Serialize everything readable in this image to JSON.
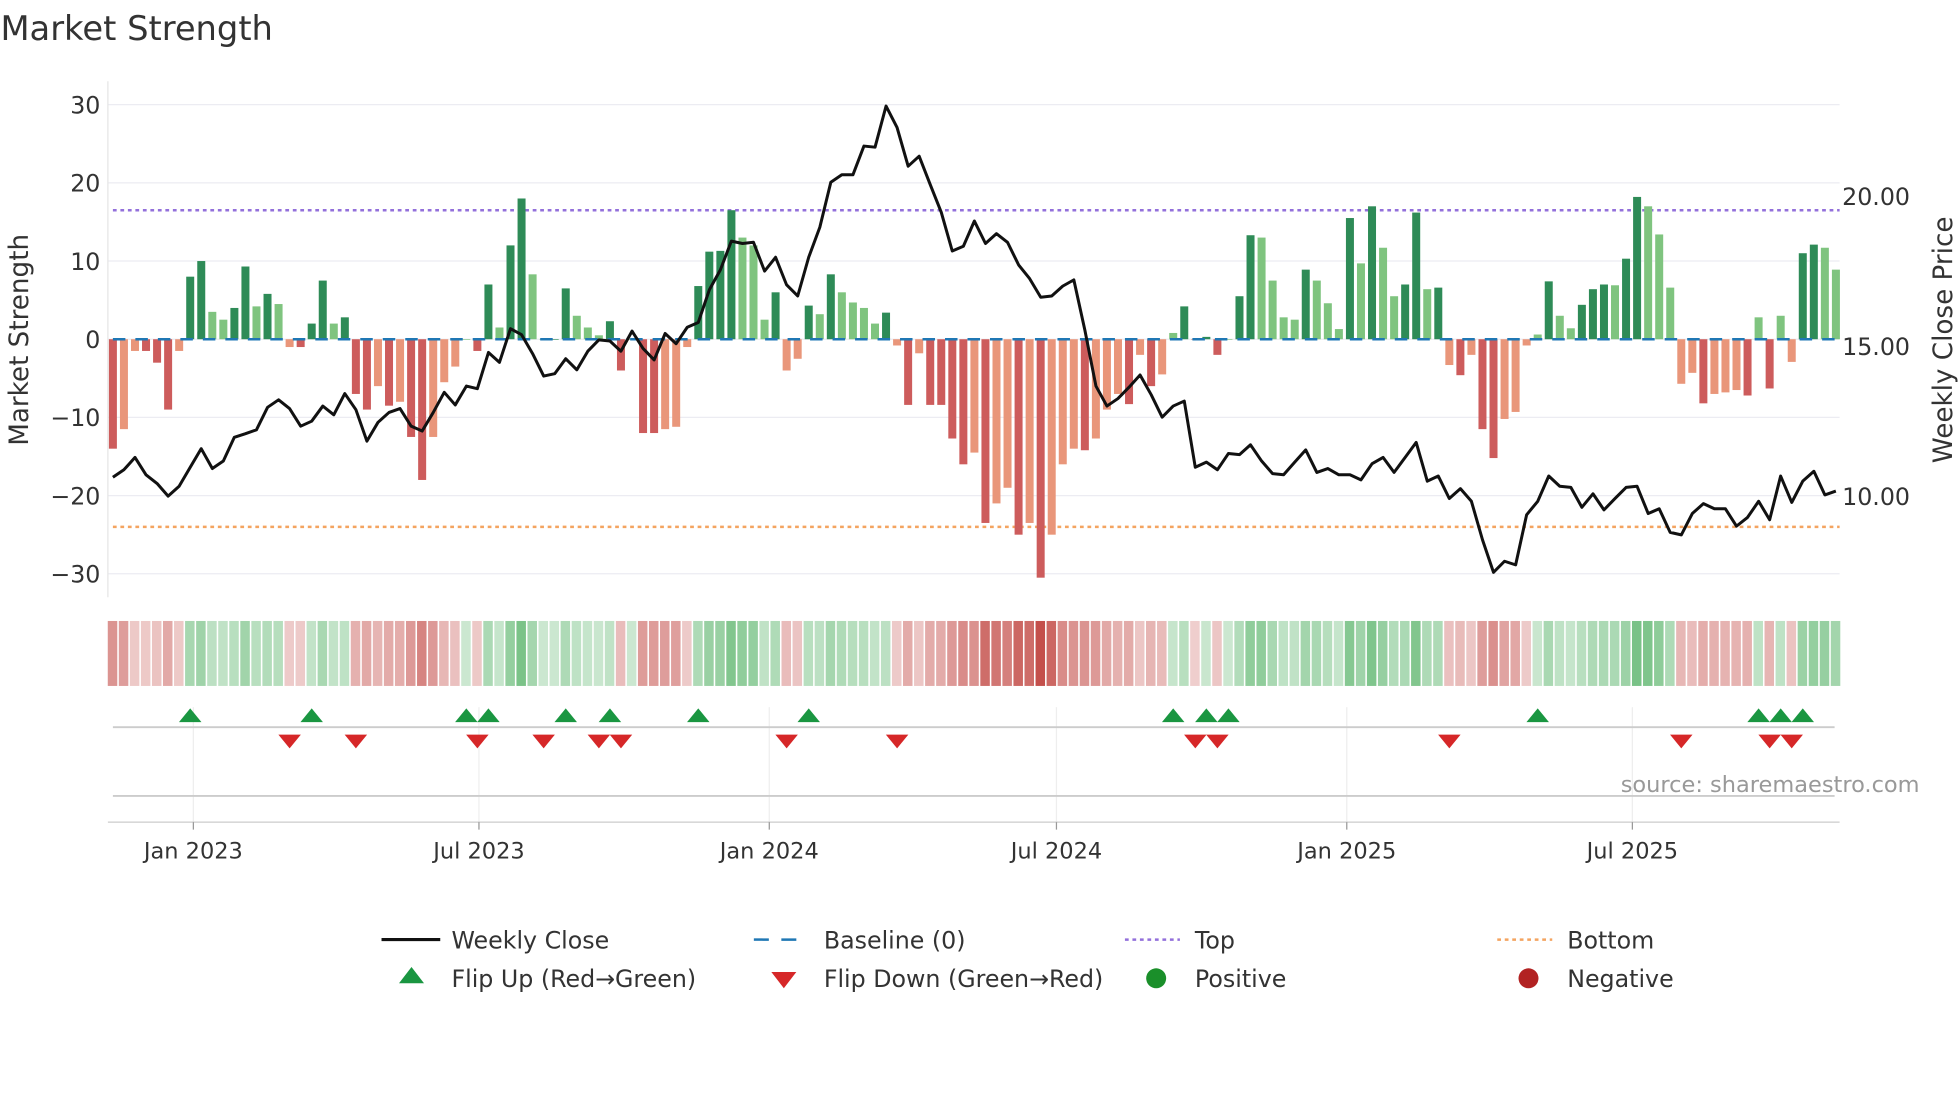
{
  "chart_data": {
    "type": "bar",
    "title": "Market Strength",
    "ylabel": "Market Strength",
    "y2label": "Weekly Close Price",
    "ylim": [
      -33,
      33
    ],
    "y2lim": [
      6.63,
      23.83
    ],
    "yticks": [
      30,
      20,
      10,
      0,
      -10,
      -20,
      -30
    ],
    "ytick_labels": [
      "30",
      "20",
      "10",
      "0",
      "−10",
      "−20",
      "−30"
    ],
    "y2ticks": [
      20,
      15,
      10
    ],
    "y2tick_labels": [
      "20.00",
      "15.00",
      "10.00"
    ],
    "x_start": "2022-11-11",
    "x_step_days": 7,
    "xticks": [
      {
        "date": "2023-01-01",
        "label": "Jan 2023"
      },
      {
        "date": "2023-07-01",
        "label": "Jul 2023"
      },
      {
        "date": "2024-01-01",
        "label": "Jan 2024"
      },
      {
        "date": "2024-07-01",
        "label": "Jul 2024"
      },
      {
        "date": "2025-01-01",
        "label": "Jan 2025"
      },
      {
        "date": "2025-07-01",
        "label": "Jul 2025"
      }
    ],
    "top_level": 16.5,
    "bottom_level": -24,
    "baseline": 0,
    "strength": [
      -14,
      -11.5,
      -1.5,
      -1.5,
      -3,
      -9,
      -1.5,
      8,
      10,
      3.5,
      2.5,
      4,
      9.3,
      4.2,
      5.8,
      4.5,
      -1,
      -1,
      2,
      7.5,
      2,
      2.8,
      -7,
      -9,
      -6,
      -8.5,
      -8,
      -12.5,
      -18,
      -12.5,
      -5.5,
      -3.5,
      0,
      -1.5,
      7,
      1.5,
      12,
      18,
      8.3,
      0,
      0,
      6.5,
      3,
      1.5,
      0.5,
      2.3,
      -4,
      0,
      -12,
      -12,
      -11.5,
      -11.2,
      -1,
      6.8,
      11.2,
      11.3,
      16.5,
      13,
      12,
      2.5,
      6,
      -4,
      -2.5,
      4.3,
      3.2,
      8.3,
      6,
      4.7,
      4,
      2,
      3.4,
      -0.8,
      -8.4,
      -1.8,
      -8.4,
      -8.4,
      -12.7,
      -16,
      -14.5,
      -23.5,
      -21,
      -19,
      -25,
      -23.5,
      -30.5,
      -25,
      -16,
      -14,
      -14.2,
      -12.7,
      -9,
      -7,
      -8.3,
      -2,
      -6,
      -4.5,
      0.8,
      4.2,
      -0.1,
      0.3,
      -2,
      0,
      5.5,
      13.3,
      13,
      7.5,
      2.8,
      2.5,
      8.9,
      7.5,
      4.6,
      1.3,
      15.5,
      9.7,
      17,
      11.7,
      5.5,
      7,
      16.2,
      6.4,
      6.6,
      -3.3,
      -4.6,
      -2,
      -11.5,
      -15.2,
      -10.2,
      -9.3,
      -0.8,
      0.6,
      7.4,
      3,
      1.4,
      4.4,
      6.4,
      7,
      6.9,
      10.3,
      18.2,
      17,
      13.4,
      6.6,
      -5.7,
      -4.3,
      -8.2,
      -7,
      -6.8,
      -6.5,
      -7.2,
      2.8,
      -6.3,
      3,
      -2.9,
      11,
      12.1,
      11.7,
      8.9
    ],
    "weekly_close": [
      10.63,
      10.88,
      11.29,
      10.71,
      10.42,
      10.0,
      10.33,
      10.96,
      11.58,
      10.92,
      11.17,
      11.96,
      12.08,
      12.21,
      12.96,
      13.21,
      12.92,
      12.33,
      12.5,
      13.0,
      12.71,
      13.42,
      12.88,
      11.83,
      12.46,
      12.79,
      12.92,
      12.33,
      12.17,
      12.79,
      13.46,
      13.04,
      13.67,
      13.58,
      14.79,
      14.46,
      15.58,
      15.38,
      14.75,
      14.0,
      14.08,
      14.58,
      14.21,
      14.83,
      15.21,
      15.17,
      14.83,
      15.5,
      14.92,
      14.54,
      15.42,
      15.08,
      15.63,
      15.79,
      16.88,
      17.54,
      18.5,
      18.42,
      18.46,
      17.5,
      17.96,
      17.04,
      16.67,
      17.96,
      18.96,
      20.46,
      20.71,
      20.71,
      21.67,
      21.63,
      23.0,
      22.29,
      21.0,
      21.33,
      20.38,
      19.46,
      18.17,
      18.33,
      19.17,
      18.42,
      18.75,
      18.46,
      17.71,
      17.25,
      16.63,
      16.67,
      17.0,
      17.21,
      15.54,
      13.67,
      13.0,
      13.25,
      13.63,
      14.04,
      13.38,
      12.63,
      13.0,
      13.17,
      10.96,
      11.13,
      10.88,
      11.42,
      11.38,
      11.71,
      11.17,
      10.75,
      10.71,
      11.13,
      11.54,
      10.79,
      10.92,
      10.71,
      10.71,
      10.54,
      11.08,
      11.29,
      10.79,
      11.29,
      11.79,
      10.5,
      10.67,
      9.92,
      10.25,
      9.83,
      8.54,
      7.46,
      7.83,
      7.71,
      9.38,
      9.83,
      10.67,
      10.33,
      10.29,
      9.63,
      10.08,
      9.54,
      9.92,
      10.29,
      10.33,
      9.42,
      9.58,
      8.79,
      8.71,
      9.42,
      9.75,
      9.58,
      9.58,
      9.0,
      9.29,
      9.83,
      9.21,
      10.67,
      9.79,
      10.5,
      10.83,
      10.04,
      10.17
    ],
    "flip_up_weeks": [
      7,
      18,
      32,
      34,
      41,
      45,
      53,
      63,
      96,
      99,
      101,
      129,
      149,
      151,
      153
    ],
    "flip_down_weeks": [
      16,
      22,
      33,
      39,
      44,
      46,
      61,
      71,
      98,
      100,
      121,
      142,
      150,
      152
    ],
    "legend": [
      {
        "key": "weekly-close",
        "label": "Weekly Close"
      },
      {
        "key": "baseline",
        "label": "Baseline (0)"
      },
      {
        "key": "top",
        "label": "Top"
      },
      {
        "key": "bottom",
        "label": "Bottom"
      },
      {
        "key": "flip-up",
        "label": "Flip Up (Red→Green)"
      },
      {
        "key": "flip-down",
        "label": "Flip Down (Green→Red)"
      },
      {
        "key": "positive",
        "label": "Positive"
      },
      {
        "key": "negative",
        "label": "Negative"
      }
    ],
    "legend_position": "bottom",
    "source": "source: sharemaestro.com"
  },
  "colors": {
    "pos_dark": "#2e8b57",
    "pos_light": "#7fc47f",
    "neg_dark": "#cd5c5c",
    "neg_light": "#e9967a",
    "top": "#9370db",
    "bottom": "#f4a460",
    "baseline": "#1f77b4",
    "flip_up": "#1a9641",
    "flip_down": "#d62728",
    "positive": "#1a8f2a",
    "negative": "#b22222"
  }
}
